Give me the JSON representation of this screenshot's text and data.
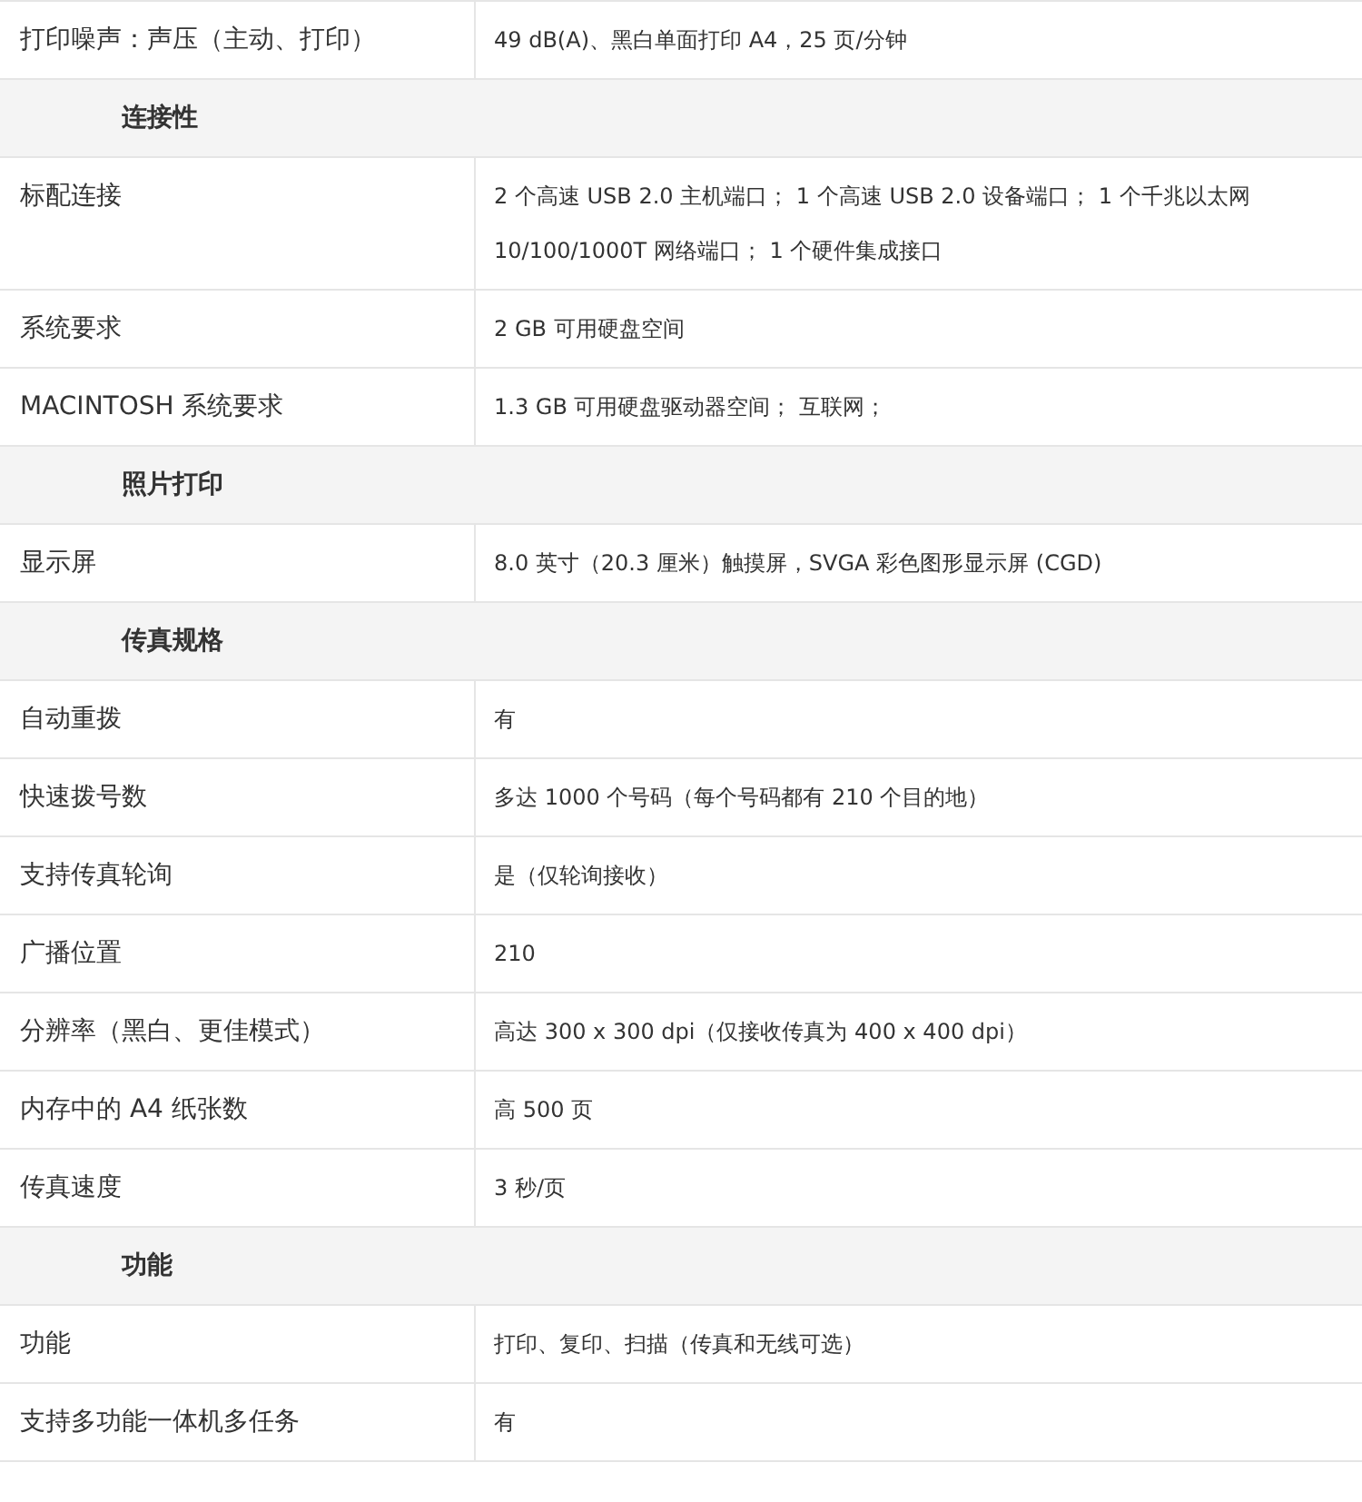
{
  "rows": [
    {
      "kind": "spec",
      "label": "打印噪声：声压（主动、打印）",
      "value": "49 dB(A)、黑白单面打印 A4，25 页/分钟"
    },
    {
      "kind": "section",
      "label": "连接性"
    },
    {
      "kind": "spec",
      "label": "标配连接",
      "value": "2 个高速 USB 2.0 主机端口； 1 个高速 USB 2.0 设备端口； 1 个千兆以太网 10/100/1000T 网络端口； 1 个硬件集成接口"
    },
    {
      "kind": "spec",
      "label": "系统要求",
      "value": "2 GB 可用硬盘空间"
    },
    {
      "kind": "spec",
      "label": "MACINTOSH 系统要求",
      "value": "1.3 GB 可用硬盘驱动器空间； 互联网；"
    },
    {
      "kind": "section",
      "label": "照片打印"
    },
    {
      "kind": "spec",
      "label": "显示屏",
      "value": "8.0 英寸（20.3 厘米）触摸屏，SVGA 彩色图形显示屏 (CGD)"
    },
    {
      "kind": "section",
      "label": "传真规格"
    },
    {
      "kind": "spec",
      "label": "自动重拨",
      "value": "有"
    },
    {
      "kind": "spec",
      "label": "快速拨号数",
      "value": "多达 1000 个号码（每个号码都有 210 个目的地）"
    },
    {
      "kind": "spec",
      "label": "支持传真轮询",
      "value": "是（仅轮询接收）"
    },
    {
      "kind": "spec",
      "label": "广播位置",
      "value": "210"
    },
    {
      "kind": "spec",
      "label": "分辨率（黑白、更佳模式）",
      "value": "高达 300 x 300 dpi（仅接收传真为 400 x 400 dpi）"
    },
    {
      "kind": "spec",
      "label": "内存中的 A4 纸张数",
      "value": "高 500 页"
    },
    {
      "kind": "spec",
      "label": "传真速度",
      "value": "3 秒/页"
    },
    {
      "kind": "section",
      "label": "功能"
    },
    {
      "kind": "spec",
      "label": "功能",
      "value": "打印、复印、扫描（传真和无线可选）"
    },
    {
      "kind": "spec",
      "label": "支持多功能一体机多任务",
      "value": "有"
    }
  ]
}
